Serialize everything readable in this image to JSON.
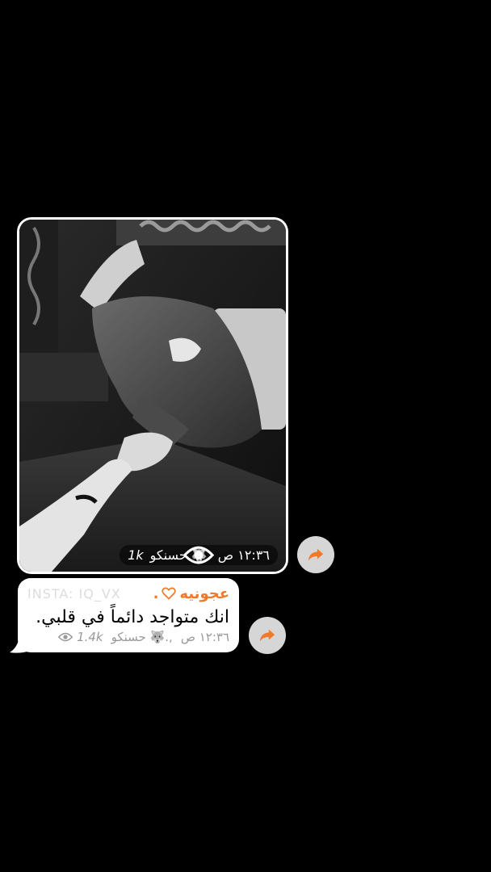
{
  "photo_message": {
    "time": "١٢:٣٦ ص",
    "author": "حسنكو 🐺.",
    "views": "1k"
  },
  "text_message": {
    "watermark": "INSTA: IQ_VX",
    "sender": "عجونيه",
    "sender_suffix": ".",
    "body": "انك متواجد دائماً في قلبي.",
    "time": "١٢:٣٦ ص",
    "author": "حسنكو 🐺.,",
    "views": "1.4k"
  },
  "colors": {
    "sender": "#f07a2a",
    "share_arrow": "#f07a2a",
    "background": "#000000"
  },
  "icons": {
    "share": "share-arrow-icon",
    "views": "eye-icon",
    "heart": "heart-icon"
  }
}
